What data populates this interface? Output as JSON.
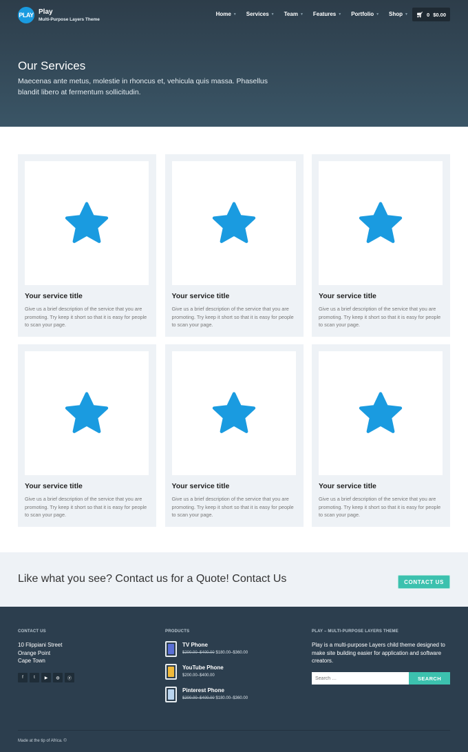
{
  "header": {
    "logo_text": "PLAY",
    "brand": "Play",
    "tagline": "Multi-Purpose Layers Theme",
    "nav": [
      "Home",
      "Services",
      "Team",
      "Features",
      "Portfolio",
      "Shop"
    ],
    "cart_count": "0",
    "cart_total": "$0.00"
  },
  "hero": {
    "title": "Our Services",
    "text": "Maecenas ante metus, molestie in rhoncus et, vehicula quis massa. Phasellus blandit libero at fermentum sollicitudin."
  },
  "services": [
    {
      "title": "Your service title",
      "desc": "Give us a brief description of the service that you are promoting. Try keep it short so that it is easy for people to scan your page.",
      "icon": "star-icon"
    },
    {
      "title": "Your service title",
      "desc": "Give us a brief description of the service that you are promoting. Try keep it short so that it is easy for people to scan your page.",
      "icon": "star-icon"
    },
    {
      "title": "Your service title",
      "desc": "Give us a brief description of the service that you are promoting. Try keep it short so that it is easy for people to scan your page.",
      "icon": "star-icon"
    },
    {
      "title": "Your service title",
      "desc": "Give us a brief description of the service that you are promoting. Try keep it short so that it is easy for people to scan your page.",
      "icon": "star-icon"
    },
    {
      "title": "Your service title",
      "desc": "Give us a brief description of the service that you are promoting. Try keep it short so that it is easy for people to scan your page.",
      "icon": "star-icon"
    },
    {
      "title": "Your service title",
      "desc": "Give us a brief description of the service that you are promoting. Try keep it short so that it is easy for people to scan your page.",
      "icon": "star-icon"
    }
  ],
  "cta": {
    "text": "Like what you see? Contact us for a Quote! Contact Us",
    "button": "CONTACT US"
  },
  "footer": {
    "contact_heading": "CONTACT US",
    "address": [
      "10 Flippiani Street",
      "Orange Point",
      "Cape Town"
    ],
    "socials": [
      "facebook-icon",
      "twitter-icon",
      "youtube-icon",
      "dribbble-icon",
      "pinterest-icon"
    ],
    "products_heading": "PRODUCTS",
    "products": [
      {
        "name": "TV Phone",
        "old_price": "$200.00–$400.00",
        "price": "$180.00–$360.00",
        "color": "#5a6fd6"
      },
      {
        "name": "YouTube Phone",
        "old_price": "",
        "price": "$200.00–$400.00",
        "color": "#f0b93a"
      },
      {
        "name": "Pinterest Phone",
        "old_price": "$200.00–$400.00",
        "price": "$180.00–$360.00",
        "color": "#b9d4ef"
      }
    ],
    "about_heading": "PLAY – MULTI-PURPOSE LAYERS THEME",
    "about_text": "Play is a multi-purpose Layers child theme designed to make site building easier for application and software creators.",
    "search_placeholder": "Search …",
    "search_button": "SEARCH",
    "copyright": "Made at the tip of Africa. ©"
  },
  "colors": {
    "accent": "#3cc1ae",
    "star": "#1a9be0",
    "footer_bg": "#2c3e4e"
  }
}
